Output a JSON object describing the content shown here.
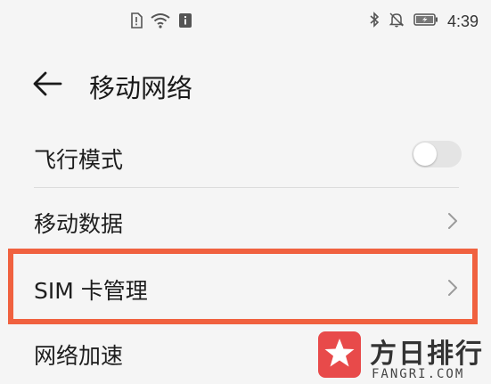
{
  "status_bar": {
    "left_icons": [
      "sim-alert-icon",
      "wifi-icon",
      "notification-app-icon"
    ],
    "right_icons": [
      "bluetooth-icon",
      "mute-icon",
      "battery-charging-icon"
    ],
    "time": "4:39"
  },
  "header": {
    "back_icon": "back-arrow-icon",
    "title": "移动网络"
  },
  "settings": {
    "airplane_mode": {
      "label": "飞行模式",
      "toggle_on": false
    },
    "mobile_data": {
      "label": "移动数据"
    },
    "sim_management": {
      "label": "SIM 卡管理",
      "highlight_color": "#f0613f"
    },
    "network_acceleration": {
      "label": "网络加速"
    }
  },
  "watermark": {
    "name": "方日排行",
    "url": "FANGRI.COM",
    "logo_color": "#e84a4a"
  }
}
